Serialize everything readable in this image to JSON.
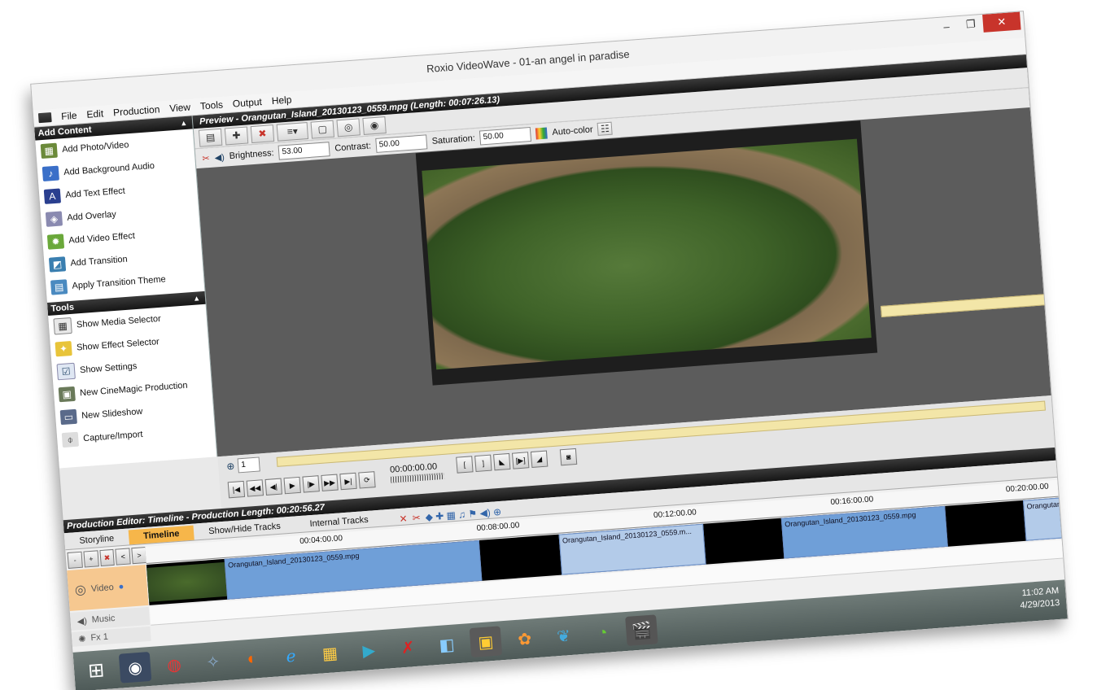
{
  "window": {
    "title": "Roxio VideoWave - 01-an angel in paradise",
    "controls": {
      "minimize": "–",
      "maximize": "❐",
      "close": "✕"
    }
  },
  "menu": [
    "File",
    "Edit",
    "Production",
    "View",
    "Tools",
    "Output",
    "Help"
  ],
  "add_content": {
    "header": "Add Content",
    "items": [
      {
        "label": "Add Photo/Video",
        "icon": "add-photo-video-icon"
      },
      {
        "label": "Add Background Audio",
        "icon": "add-audio-icon"
      },
      {
        "label": "Add Text Effect",
        "icon": "add-text-icon"
      },
      {
        "label": "Add Overlay",
        "icon": "add-overlay-icon"
      },
      {
        "label": "Add Video Effect",
        "icon": "add-video-effect-icon"
      },
      {
        "label": "Add Transition",
        "icon": "add-transition-icon"
      },
      {
        "label": "Apply Transition Theme",
        "icon": "transition-theme-icon"
      }
    ]
  },
  "tools": {
    "header": "Tools",
    "items": [
      {
        "label": "Show Media Selector",
        "icon": "media-selector-icon"
      },
      {
        "label": "Show Effect Selector",
        "icon": "effect-selector-icon"
      },
      {
        "label": "Show Settings",
        "icon": "settings-icon"
      },
      {
        "label": "New CineMagic Production",
        "icon": "cinemagic-icon"
      },
      {
        "label": "New Slideshow",
        "icon": "slideshow-icon"
      },
      {
        "label": "Capture/Import",
        "icon": "capture-icon"
      }
    ]
  },
  "preview": {
    "header": "Preview - Orangutan_Island_20130123_0559.mpg (Length: 00:07:26.13)",
    "brightness_label": "Brightness:",
    "brightness": "53.00",
    "contrast_label": "Contrast:",
    "contrast": "50.00",
    "saturation_label": "Saturation:",
    "saturation": "50.00",
    "autocolor_label": "Auto-color"
  },
  "transport": {
    "frame": "1",
    "timecode": "00:00:00.00"
  },
  "production_editor": {
    "header": "Production Editor: Timeline - Production Length: 00:20:56.27",
    "tabs": [
      "Storyline",
      "Timeline",
      "Show/Hide Tracks",
      "Internal Tracks"
    ],
    "active_tab": "Timeline",
    "ruler": [
      "00:04:00.00",
      "00:08:00.00",
      "00:12:00.00",
      "00:16:00.00",
      "00:20:00.00"
    ],
    "tracks": [
      "Video",
      "Music",
      "Fx 1"
    ],
    "clips": [
      "Orangutan_Island_20130123_0559.mpg",
      "Orangutan_Island_20130123_0559.m...",
      "Orangutan_Island_20130123_0559.mpg",
      "Orangutan_I"
    ],
    "zoom_buttons": [
      "-",
      "+",
      "<",
      ">"
    ]
  },
  "taskbar": {
    "time": "11:02 AM",
    "date": "4/29/2013"
  },
  "colors": {
    "clip_dark": "#6f9fd8",
    "clip_light": "#b3cbe9",
    "active_tab": "#f6b64a",
    "scrub_bar": "#f3e6a8",
    "close_button": "#c8342b"
  }
}
